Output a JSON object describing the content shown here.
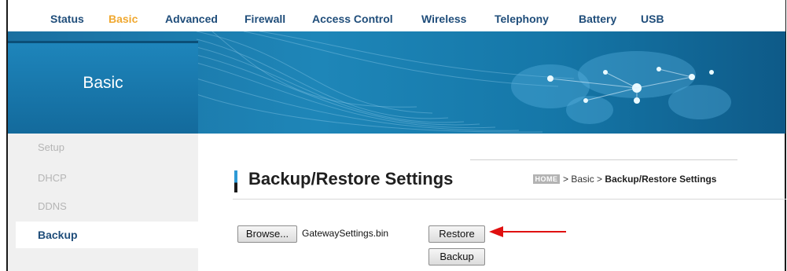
{
  "nav": {
    "items": [
      {
        "label": "Status",
        "active": false
      },
      {
        "label": "Basic",
        "active": true
      },
      {
        "label": "Advanced",
        "active": false
      },
      {
        "label": "Firewall",
        "active": false
      },
      {
        "label": "Access Control",
        "active": false
      },
      {
        "label": "Wireless",
        "active": false
      },
      {
        "label": "Telephony",
        "active": false
      },
      {
        "label": "Battery",
        "active": false
      },
      {
        "label": "USB",
        "active": false
      }
    ],
    "active_color": "#f0a830",
    "text_color": "#1f4d7a"
  },
  "banner": {
    "section_title": "Basic",
    "accent_color": "#1e85bb"
  },
  "sidebar": {
    "items": [
      {
        "label": "Setup",
        "active": false
      },
      {
        "label": "DHCP",
        "active": false
      },
      {
        "label": "DDNS",
        "active": false
      },
      {
        "label": "Backup",
        "active": true
      }
    ]
  },
  "main": {
    "page_title": "Backup/Restore Settings",
    "breadcrumb": {
      "home_badge": "HOME",
      "separator": ">",
      "parent": "Basic",
      "current": "Backup/Restore Settings"
    },
    "browse_label": "Browse...",
    "selected_file": "GatewaySettings.bin",
    "restore_label": "Restore",
    "backup_label": "Backup",
    "annotation_arrow_color": "#e01010"
  }
}
